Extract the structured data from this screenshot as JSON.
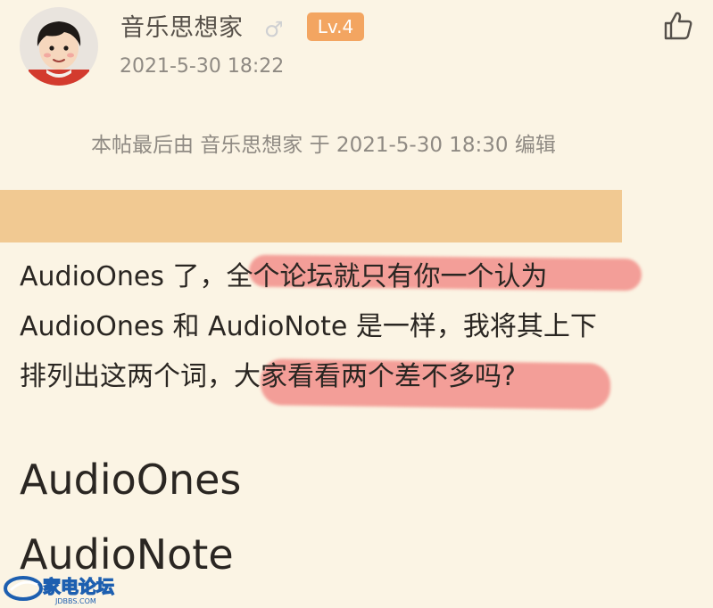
{
  "post": {
    "author": {
      "name": "音乐思想家",
      "gender_symbol": "♂",
      "level": "Lv.4",
      "avatar": "cartoon-boy-avatar"
    },
    "timestamp": "2021-5-30 18:22",
    "like_icon": "thumbs-up-icon",
    "edit_note": "本帖最后由 音乐思想家 于 2021-5-30 18:30 编辑",
    "body": {
      "line1": "AudioOnes 了，全个论坛就只有你一个认为",
      "line2": "AudioOnes 和 AudioNote 是一样，我将其上下",
      "line3": "排列出这两个词，大家看看两个差不多吗?",
      "word1": "AudioOnes",
      "word2": "AudioNote"
    }
  },
  "watermark": {
    "text": "家电论坛",
    "subtext": "JDBBS.COM"
  },
  "colors": {
    "background": "#fbf4e4",
    "level_badge": "#f3a561",
    "quote_bar": "#f1c992",
    "highlight": "#ee6060"
  }
}
